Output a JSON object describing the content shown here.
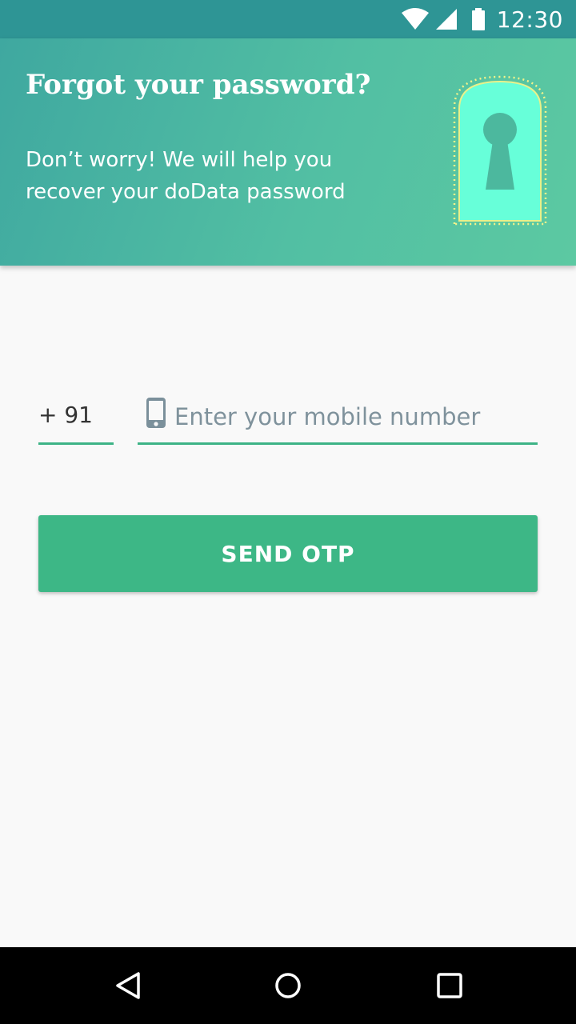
{
  "status_bar": {
    "time": "12:30",
    "icons": [
      "wifi-icon",
      "signal-icon",
      "battery-icon"
    ],
    "background": "#2e9595"
  },
  "header": {
    "title": "Forgot your password?",
    "subtitle": "Don’t worry! We will help you recover your doData password",
    "illustration": "keyhole-door-icon",
    "gradient": [
      "#3fa8a0",
      "#5cc9a2"
    ]
  },
  "form": {
    "country_code": "+ 91",
    "mobile": {
      "icon": "phone-icon",
      "value": "",
      "placeholder": "Enter your mobile number"
    },
    "send_button_label": "SEND OTP",
    "accent_color": "#3db786"
  },
  "nav_bar": {
    "buttons": [
      "back-icon",
      "home-icon",
      "recents-icon"
    ]
  }
}
